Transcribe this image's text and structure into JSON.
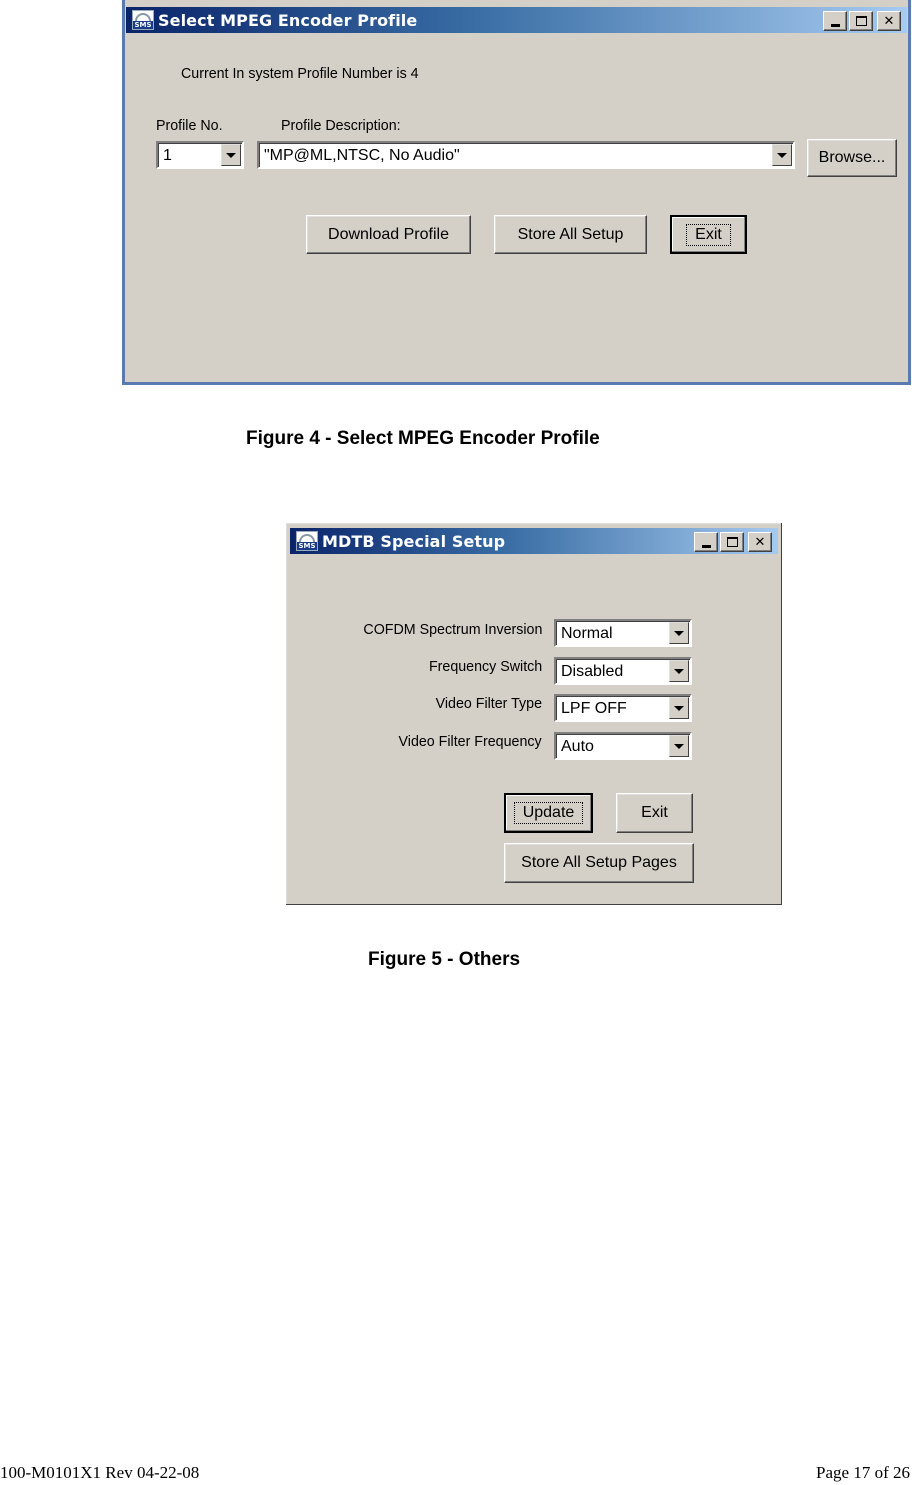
{
  "figure4": {
    "window": {
      "title": "Select MPEG Encoder Profile",
      "icon": "sms-app-icon",
      "controls": {
        "minimize": "minimize",
        "maximize": "maximize",
        "close": "×"
      }
    },
    "status_text": "Current In system Profile Number is 4",
    "profile_no_label": "Profile No.",
    "profile_no_value": "1",
    "profile_desc_label": "Profile Description:",
    "profile_desc_value": "\"MP@ML,NTSC, No Audio\"",
    "browse_label": "Browse...",
    "buttons": {
      "download": "Download Profile",
      "store": "Store All Setup",
      "exit": "Exit"
    },
    "caption": "Figure 4 - Select MPEG Encoder Profile"
  },
  "figure5": {
    "window": {
      "title": "MDTB Special Setup",
      "icon": "sms-app-icon"
    },
    "fields": [
      {
        "label": "COFDM Spectrum Inversion",
        "value": "Normal"
      },
      {
        "label": "Frequency Switch",
        "value": "Disabled"
      },
      {
        "label": "Video Filter Type",
        "value": "LPF OFF"
      },
      {
        "label": "Video Filter Frequency",
        "value": "Auto"
      }
    ],
    "buttons": {
      "update": "Update",
      "exit": "Exit",
      "store_pages": "Store All Setup Pages"
    },
    "caption": "Figure 5 - Others"
  },
  "footer": {
    "doc_id": "100-M0101X1 Rev 04-22-08",
    "page": "Page 17 of 26"
  }
}
